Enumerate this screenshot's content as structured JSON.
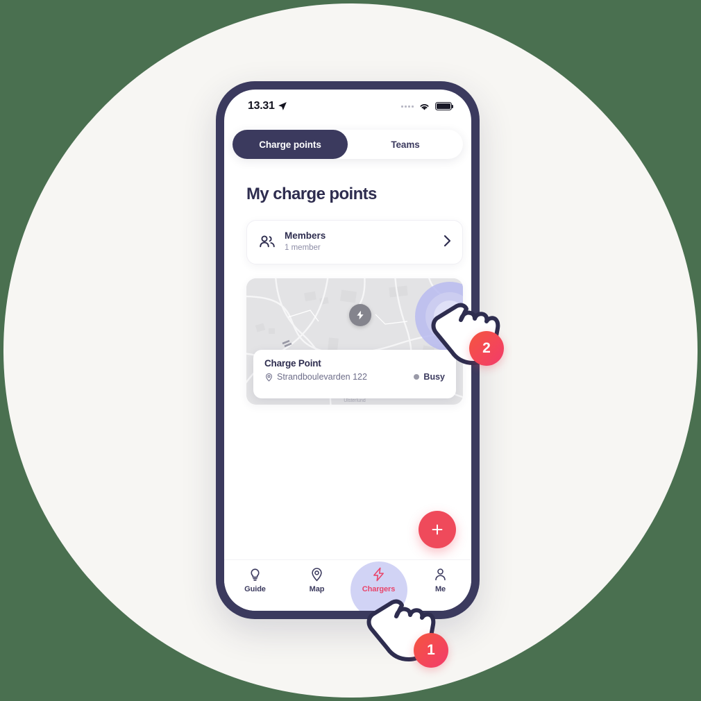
{
  "scene": {
    "background_color": "#4a7050",
    "circle_color": "#f7f6f3",
    "phone_frame_color": "#3b3a5e",
    "accent_color": "#e8456b",
    "fab_color": "#ef4a5b",
    "badge_gradient_from": "#f4553f",
    "badge_gradient_to": "#f33b6b",
    "ripple_color": "#c6c8f2"
  },
  "status_bar": {
    "time": "13.31",
    "location_icon": "location-arrow-icon",
    "signal_icon": "signal-dots-icon",
    "wifi_icon": "wifi-icon",
    "battery_icon": "battery-full-icon"
  },
  "segmented_control": {
    "tabs": [
      {
        "label": "Charge points",
        "active": true
      },
      {
        "label": "Teams",
        "active": false
      }
    ]
  },
  "main": {
    "page_title": "My charge points",
    "members_card": {
      "icon": "members-icon",
      "title": "Members",
      "subtitle": "1 member",
      "chevron_icon": "chevron-right-icon"
    },
    "charge_point_card": {
      "map_icons": {
        "bolt_pin": "bolt-pin-icon",
        "settings": "gear-icon"
      },
      "name": "Charge Point",
      "address_icon": "map-pin-icon",
      "address": "Strandboulevarden 122",
      "status": "Busy",
      "status_dot_color": "#9a9aa8",
      "map_label": "Ulsterlund"
    },
    "fab": {
      "icon": "plus-icon",
      "label": "+"
    }
  },
  "bottom_nav": {
    "items": [
      {
        "label": "Guide",
        "icon": "lightbulb-icon",
        "active": false
      },
      {
        "label": "Map",
        "icon": "map-pin-icon",
        "active": false
      },
      {
        "label": "Chargers",
        "icon": "bolt-icon",
        "active": true
      },
      {
        "label": "Me",
        "icon": "person-icon",
        "active": false
      }
    ]
  },
  "annotations": {
    "steps": [
      {
        "number": "1",
        "target": "chargers-tab"
      },
      {
        "number": "2",
        "target": "charge-point-settings"
      }
    ],
    "cursor_icon": "pointing-hand-cursor"
  }
}
